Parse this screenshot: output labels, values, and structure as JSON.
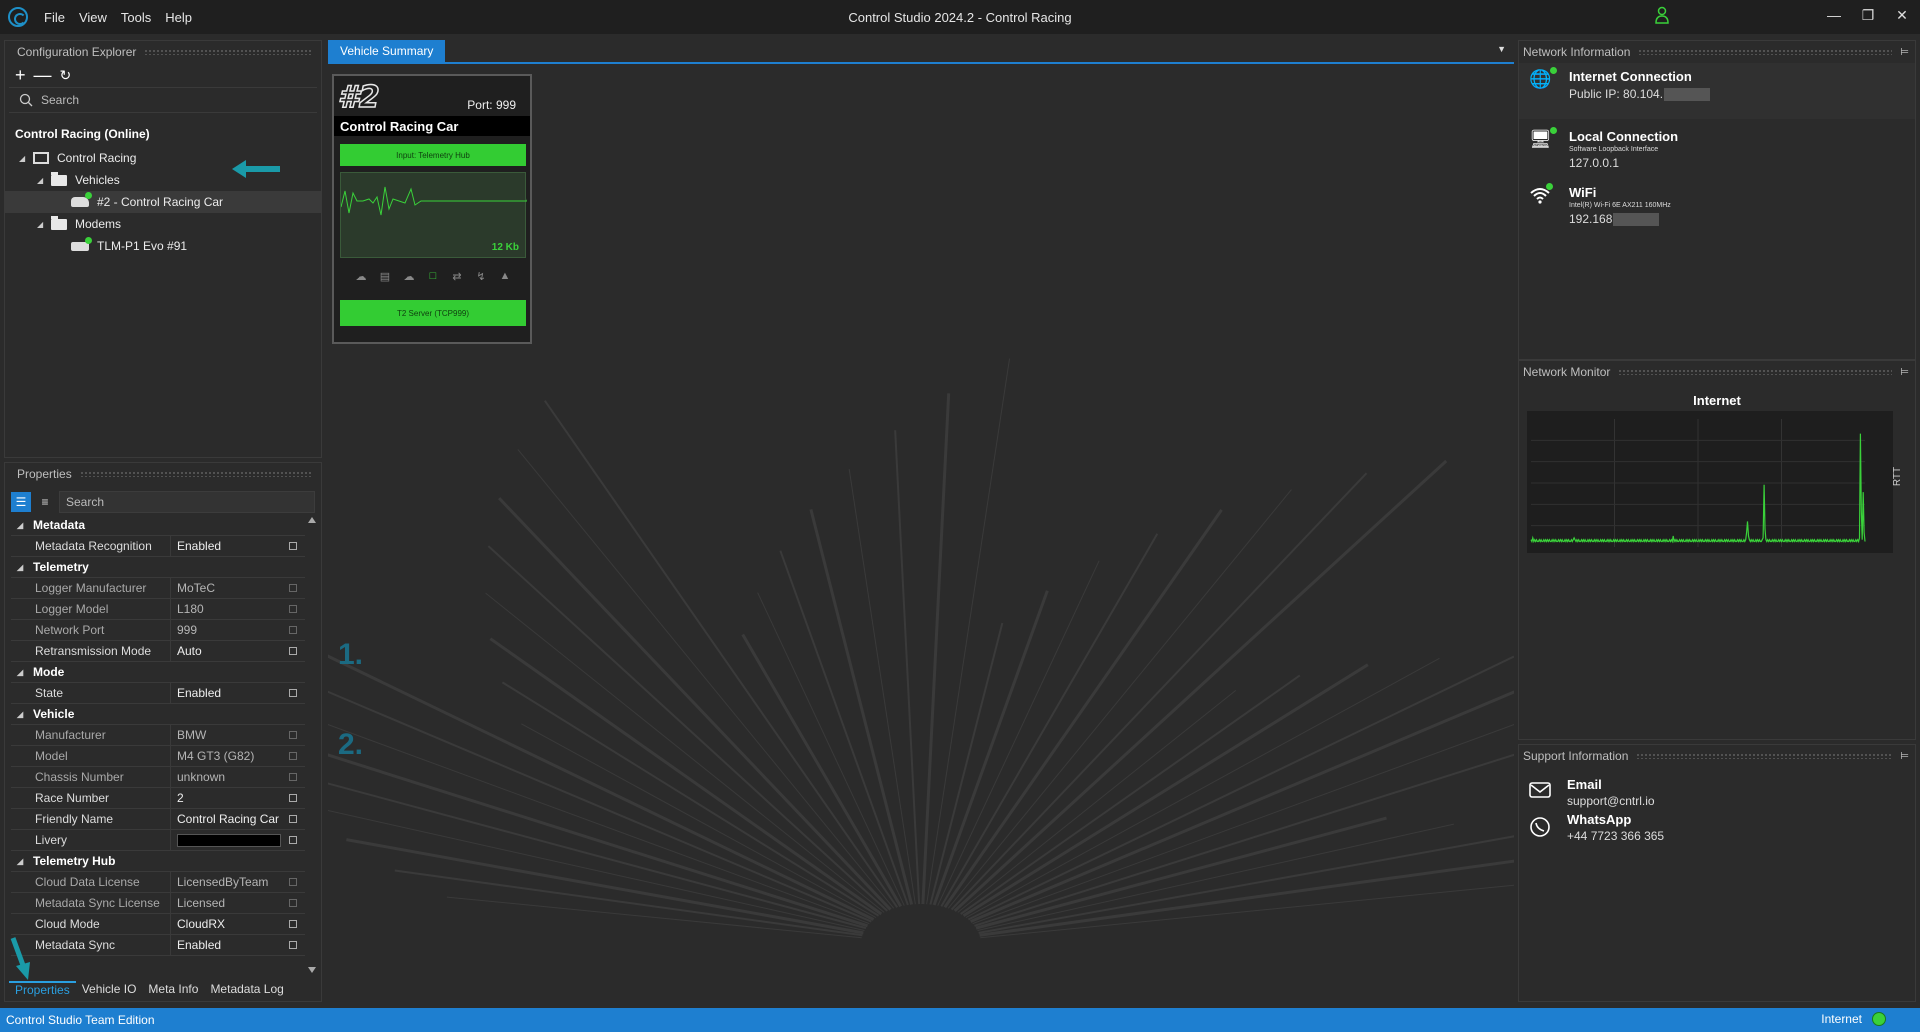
{
  "window": {
    "title": "Control Studio 2024.2 - Control Racing",
    "menu": [
      "File",
      "View",
      "Tools",
      "Help"
    ]
  },
  "explorer": {
    "header": "Configuration Explorer",
    "search_placeholder": "Search",
    "root": "Control Racing (Online)",
    "org": "Control Racing",
    "vehicles_folder": "Vehicles",
    "vehicle": "#2 - Control Racing Car",
    "modems_folder": "Modems",
    "modem": "TLM-P1 Evo #91"
  },
  "properties": {
    "header": "Properties",
    "search_placeholder": "Search",
    "categories": {
      "metadata": "Metadata",
      "telemetry": "Telemetry",
      "mode": "Mode",
      "vehicle": "Vehicle",
      "telemetry_hub": "Telemetry Hub"
    },
    "rows": {
      "metadata_recognition": {
        "name": "Metadata Recognition",
        "value": "Enabled"
      },
      "logger_manufacturer": {
        "name": "Logger Manufacturer",
        "value": "MoTeC"
      },
      "logger_model": {
        "name": "Logger Model",
        "value": "L180"
      },
      "network_port": {
        "name": "Network Port",
        "value": "999"
      },
      "retransmission_mode": {
        "name": "Retransmission Mode",
        "value": "Auto"
      },
      "state": {
        "name": "State",
        "value": "Enabled"
      },
      "manufacturer": {
        "name": "Manufacturer",
        "value": "BMW"
      },
      "model": {
        "name": "Model",
        "value": "M4 GT3 (G82)"
      },
      "chassis_number": {
        "name": "Chassis Number",
        "value": "unknown"
      },
      "race_number": {
        "name": "Race Number",
        "value": "2"
      },
      "friendly_name": {
        "name": "Friendly Name",
        "value": "Control Racing Car"
      },
      "livery": {
        "name": "Livery",
        "value": ""
      },
      "cloud_data_license": {
        "name": "Cloud Data License",
        "value": "LicensedByTeam"
      },
      "metadata_sync_license": {
        "name": "Metadata Sync License",
        "value": "Licensed"
      },
      "cloud_mode": {
        "name": "Cloud Mode",
        "value": "CloudRX"
      },
      "metadata_sync": {
        "name": "Metadata Sync",
        "value": "Enabled"
      }
    },
    "tabs": [
      "Properties",
      "Vehicle IO",
      "Meta Info",
      "Metadata Log"
    ]
  },
  "document": {
    "tab": "Vehicle Summary",
    "card": {
      "number": "#2",
      "port": "Port: 999",
      "name": "Control Racing Car",
      "input": "Input: Telemetry Hub",
      "data_amount": "12 Kb",
      "server": "T2 Server (TCP999)"
    },
    "step1": "1.",
    "step2": "2."
  },
  "network_info": {
    "header": "Network Information",
    "internet": {
      "title": "Internet Connection",
      "value": "Public IP: 80.104."
    },
    "local": {
      "title": "Local Connection",
      "sub": "Software Loopback Interface",
      "value": "127.0.0.1"
    },
    "wifi": {
      "title": "WiFi",
      "sub": "Intel(R) Wi-Fi 6E AX211 160MHz",
      "value": "192.168"
    }
  },
  "network_monitor": {
    "header": "Network Monitor",
    "title": "Internet",
    "axis_label": "RTT"
  },
  "chart_data": {
    "type": "line",
    "title": "Internet",
    "ylabel": "RTT",
    "xlabel": "",
    "grid": true,
    "values": [
      4,
      3,
      5,
      3,
      4,
      3,
      4,
      3,
      3,
      4,
      3,
      4,
      3,
      3,
      4,
      3,
      4,
      3,
      4,
      3,
      4,
      3,
      3,
      4,
      3,
      4,
      3,
      4,
      3,
      3,
      4,
      3,
      4,
      3,
      4,
      3,
      3,
      4,
      3,
      4,
      3,
      4,
      3,
      3,
      4,
      3,
      4,
      5,
      4,
      3,
      4,
      3,
      4,
      3,
      3,
      4,
      3,
      4,
      3,
      4,
      3,
      3,
      4,
      3,
      4,
      3,
      4,
      3,
      3,
      4,
      3,
      4,
      3,
      4,
      3,
      3,
      4,
      3,
      4,
      3,
      4,
      3,
      3,
      4,
      3,
      4,
      3,
      4,
      3,
      3,
      4,
      3,
      4,
      3,
      4,
      3,
      3,
      4,
      3,
      4,
      3,
      4,
      3,
      3,
      4,
      3,
      4,
      3,
      3,
      4,
      3,
      4,
      3,
      4,
      3,
      3,
      4,
      3,
      4,
      3,
      4,
      3,
      3,
      4,
      3,
      4,
      3,
      4,
      3,
      3,
      4,
      3,
      4,
      3,
      4,
      3,
      3,
      4,
      3,
      4,
      3,
      4,
      3,
      3,
      4,
      3,
      4,
      3,
      4,
      3,
      3,
      4,
      3,
      4,
      3,
      6,
      3,
      4,
      3,
      4,
      3,
      3,
      4,
      3,
      4,
      3,
      4,
      3,
      3,
      4,
      3,
      4,
      3,
      4,
      3,
      3,
      4,
      3,
      4,
      3,
      4,
      3,
      3,
      4,
      3,
      4,
      3,
      4,
      3,
      3,
      4,
      3,
      4,
      3,
      4,
      3,
      3,
      4,
      3,
      4,
      3,
      4,
      3,
      3,
      4,
      3,
      4,
      3,
      4,
      3,
      3,
      4,
      3,
      4,
      3,
      4,
      3,
      3,
      4,
      3,
      4,
      3,
      4,
      3,
      3,
      4,
      3,
      4,
      3,
      4,
      3,
      3,
      4,
      3,
      4,
      8,
      14,
      6,
      4,
      3,
      4,
      3,
      4,
      3,
      3,
      4,
      3,
      4,
      3,
      4,
      3,
      3,
      4,
      5,
      34,
      10,
      4,
      3,
      4,
      3,
      4,
      3,
      3,
      4,
      3,
      4,
      3,
      4,
      3,
      3,
      4,
      3,
      4,
      3,
      4,
      3,
      3,
      4,
      3,
      4,
      3,
      4,
      3,
      3,
      4,
      3,
      4,
      3,
      4,
      3,
      3,
      4,
      3,
      4,
      3,
      4,
      3,
      3,
      4,
      3,
      4,
      3,
      4,
      3,
      3,
      4,
      3,
      4,
      3,
      4,
      3,
      3,
      4,
      3,
      4,
      3,
      4,
      3,
      3,
      4,
      3,
      4,
      3,
      4,
      3,
      3,
      4,
      3,
      4,
      3,
      4,
      3,
      3,
      4,
      3,
      4,
      3,
      4,
      3,
      3,
      4,
      3,
      4,
      3,
      4,
      3,
      3,
      4,
      3,
      4,
      3,
      4,
      3,
      3,
      4,
      3,
      4,
      3,
      5,
      62,
      20,
      4,
      30,
      8,
      3
    ],
    "ylim": [
      0,
      70
    ]
  },
  "support": {
    "header": "Support Information",
    "email_title": "Email",
    "email": "support@cntrl.io",
    "whatsapp_title": "WhatsApp",
    "phone": "+44 7723 366 365"
  },
  "statusbar": {
    "left": "Control Studio Team Edition",
    "right": "Internet"
  }
}
